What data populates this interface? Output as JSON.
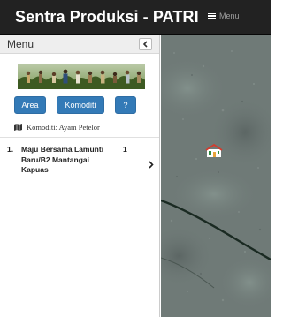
{
  "header": {
    "title": "Sentra Produksi - PATRI",
    "menu_label": "Menu"
  },
  "sidebar": {
    "title": "Menu",
    "buttons": {
      "area": "Area",
      "komoditi": "Komoditi",
      "help": "?"
    },
    "komoditi_line": "Komoditi: Ayam Petelor",
    "results": [
      {
        "number": "1.",
        "name": "Maju Bersama Lamunti Baru/B2 Mantangai Kapuas",
        "count": "1"
      }
    ]
  },
  "colors": {
    "navbar": "#222222",
    "button": "#337ab7",
    "map_base": "#6f7a77"
  },
  "icons": {
    "menu": "hamburger-icon",
    "collapse": "chevron-left-icon",
    "komoditi": "map-icon",
    "row": "chevron-right-icon",
    "marker": "house-marker-icon"
  }
}
